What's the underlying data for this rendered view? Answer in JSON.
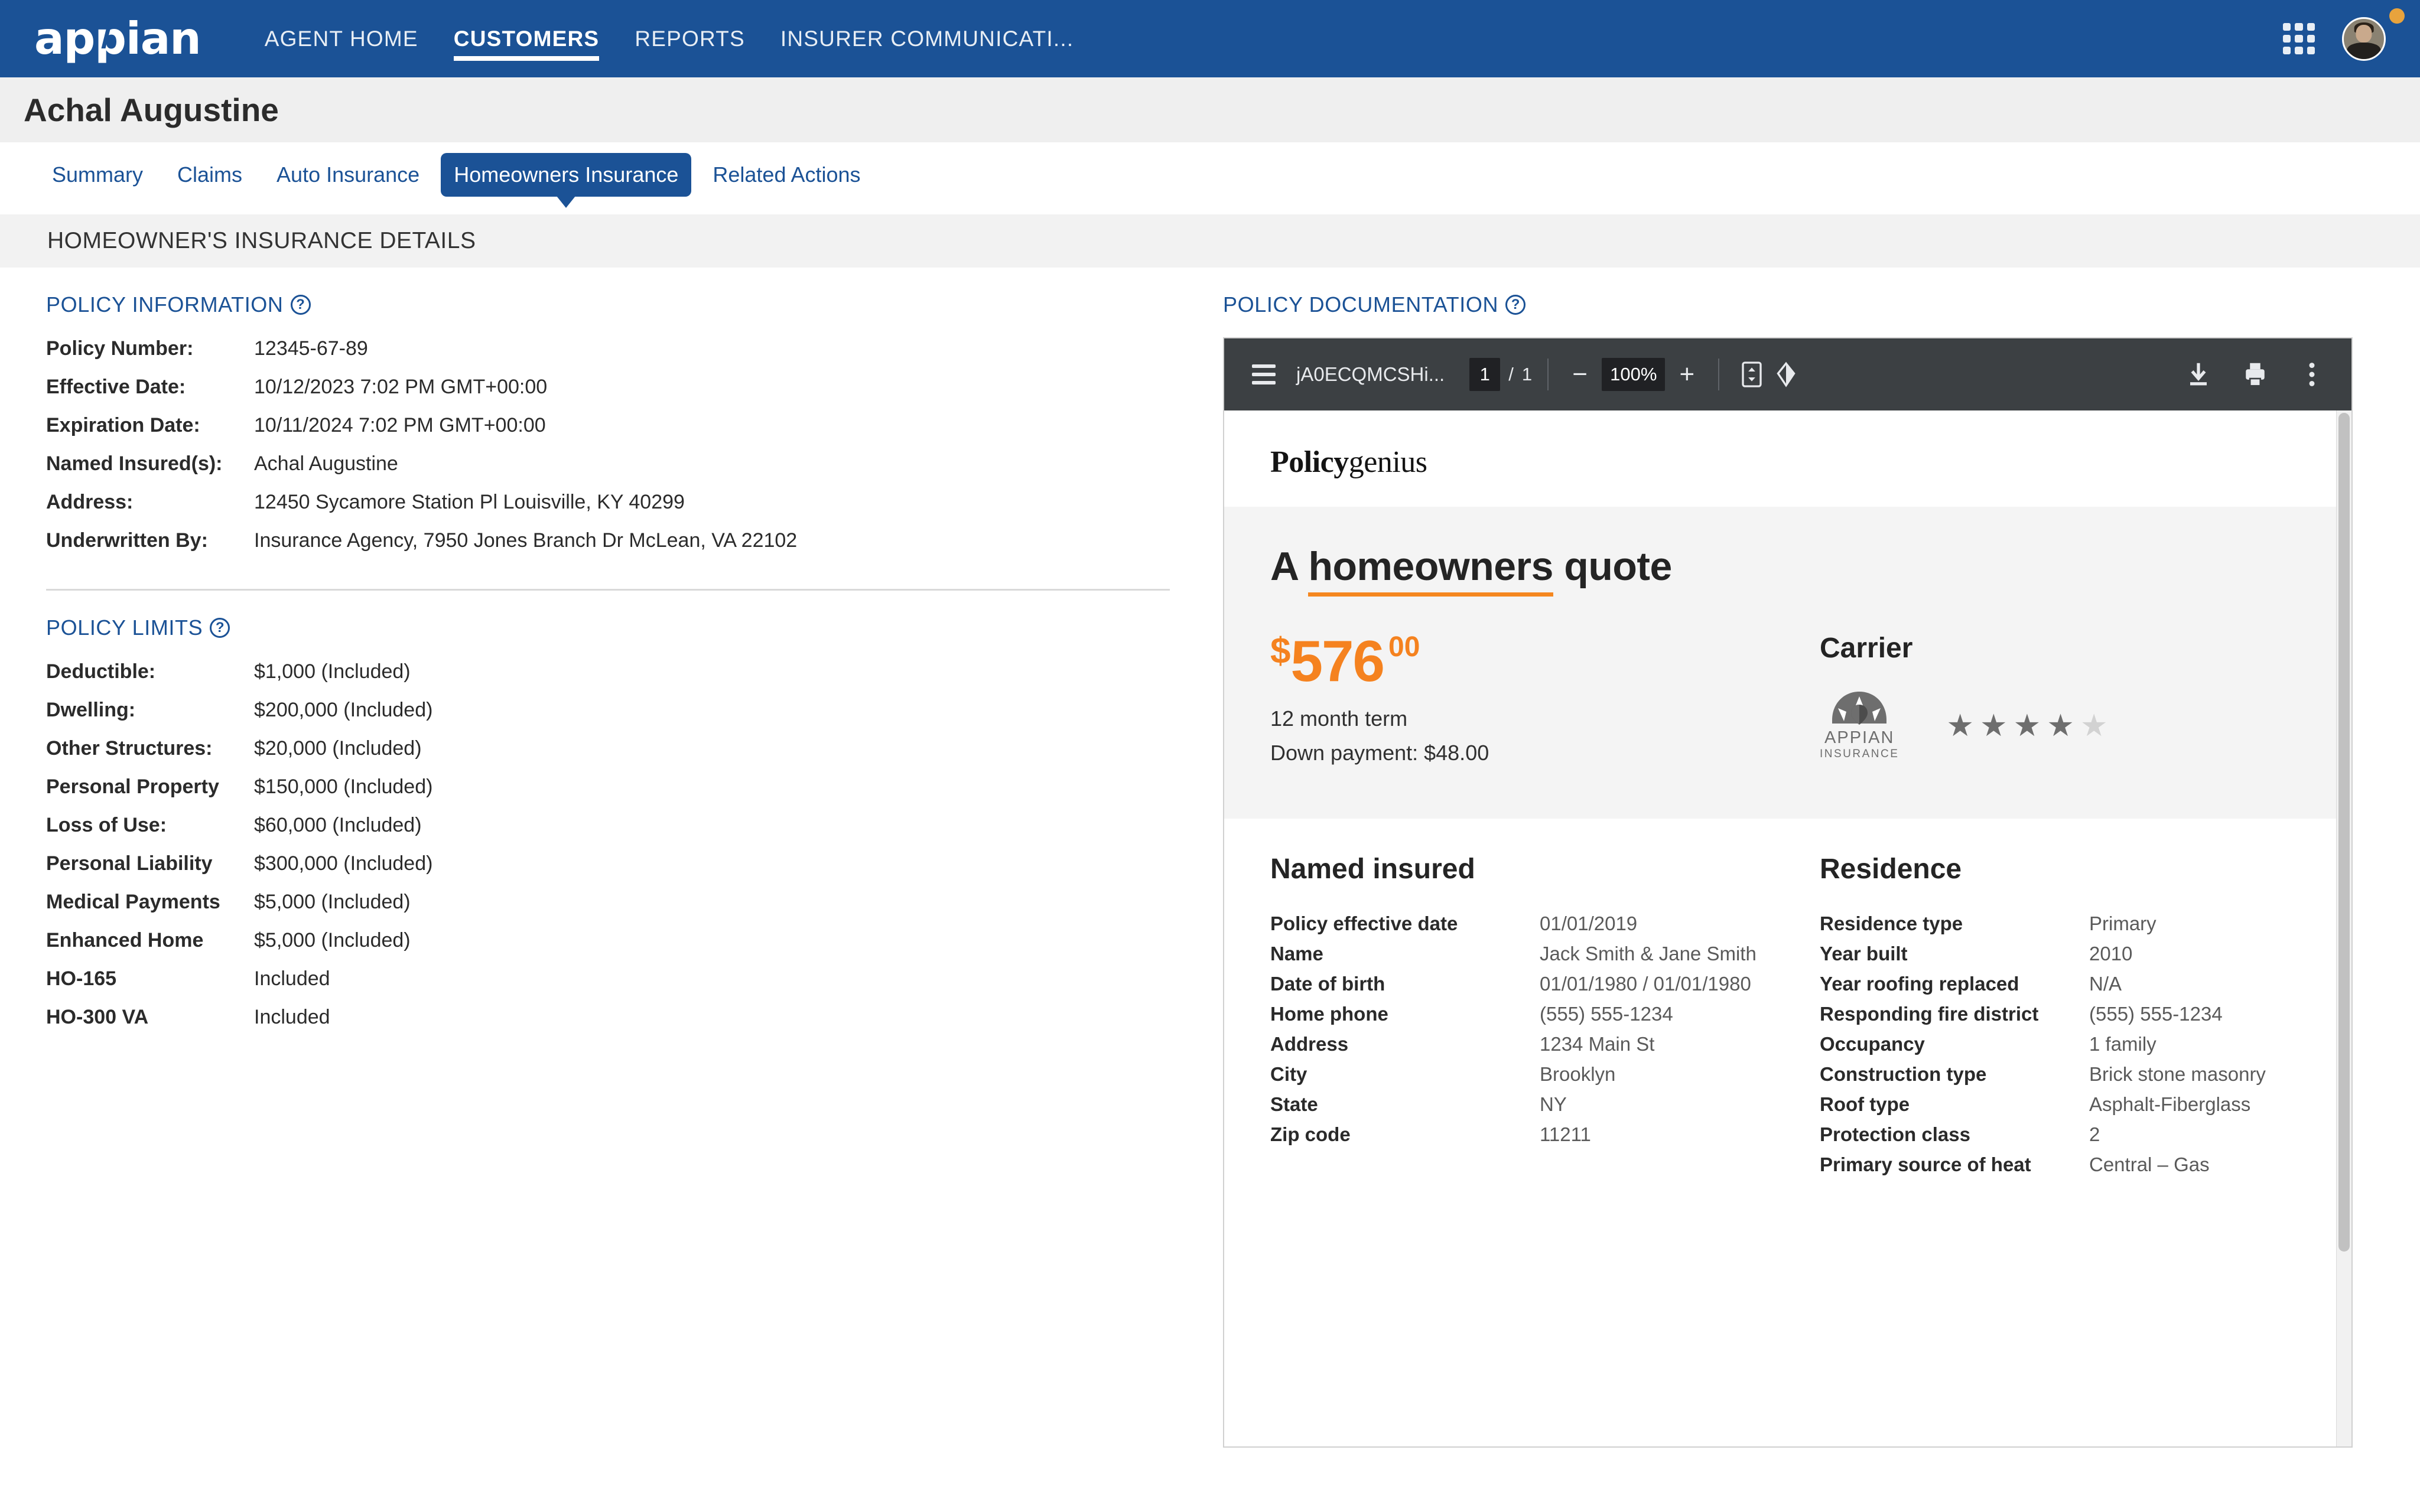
{
  "nav": {
    "logo": "appian",
    "items": [
      {
        "label": "AGENT HOME",
        "active": false
      },
      {
        "label": "CUSTOMERS",
        "active": true
      },
      {
        "label": "REPORTS",
        "active": false
      },
      {
        "label": "INSURER COMMUNICATI...",
        "active": false
      }
    ],
    "brand_color": "#1B5296"
  },
  "page": {
    "title": "Achal Augustine"
  },
  "tabs": [
    {
      "label": "Summary",
      "active": false
    },
    {
      "label": "Claims",
      "active": false
    },
    {
      "label": "Auto Insurance",
      "active": false
    },
    {
      "label": "Homeowners Insurance",
      "active": true
    },
    {
      "label": "Related Actions",
      "active": false
    }
  ],
  "section_band": {
    "title": "HOMEOWNER'S INSURANCE DETAILS"
  },
  "policy_information": {
    "header": "POLICY INFORMATION",
    "help": "?",
    "rows": [
      {
        "label": "Policy Number:",
        "value": "12345-67-89"
      },
      {
        "label": "Effective Date:",
        "value": "10/12/2023 7:02 PM GMT+00:00"
      },
      {
        "label": "Expiration Date:",
        "value": "10/11/2024 7:02 PM GMT+00:00"
      },
      {
        "label": "Named Insured(s):",
        "value": "Achal Augustine"
      },
      {
        "label": "Address:",
        "value": "12450 Sycamore Station Pl Louisville, KY 40299"
      },
      {
        "label": "Underwritten By:",
        "value": "Insurance Agency, 7950 Jones Branch Dr McLean, VA 22102"
      }
    ]
  },
  "policy_limits": {
    "header": "POLICY LIMITS",
    "help": "?",
    "rows": [
      {
        "label": "Deductible:",
        "value": "$1,000 (Included)"
      },
      {
        "label": "Dwelling:",
        "value": "$200,000 (Included)"
      },
      {
        "label": "Other Structures:",
        "value": "$20,000 (Included)"
      },
      {
        "label": "Personal Property",
        "value": "$150,000 (Included)"
      },
      {
        "label": "Loss of Use:",
        "value": "$60,000 (Included)"
      },
      {
        "label": "Personal Liability",
        "value": "$300,000 (Included)"
      },
      {
        "label": "Medical Payments",
        "value": "$5,000 (Included)"
      },
      {
        "label": "Enhanced Home",
        "value": "$5,000 (Included)"
      },
      {
        "label": "HO-165",
        "value": "Included"
      },
      {
        "label": "HO-300 VA",
        "value": "Included"
      }
    ]
  },
  "policy_documentation": {
    "header": "POLICY DOCUMENTATION",
    "help": "?"
  },
  "pdf_viewer": {
    "filename": "jA0ECQMCSHi...",
    "current_page": "1",
    "page_separator": "/",
    "total_pages": "1",
    "zoom_out": "−",
    "zoom_level": "100%",
    "zoom_in": "+",
    "icons": {
      "menu": "hamburger-icon",
      "fit": "fit-page-icon",
      "rotate": "rotate-icon",
      "download": "download-icon",
      "print": "print-icon",
      "more": "more-options-icon"
    }
  },
  "document": {
    "brand_bold": "Policy",
    "brand_light": "genius",
    "title_pre": "A ",
    "title_underlined": "homeowners",
    "title_post": " quote",
    "price": {
      "currency": "$",
      "amount": "576",
      "cents": "00",
      "term": "12 month term",
      "down_payment": "Down payment: $48.00"
    },
    "carrier": {
      "title": "Carrier",
      "name": "APPIAN",
      "subname": "INSURANCE",
      "rating_filled": 4,
      "rating_total": 5
    },
    "named_insured": {
      "title": "Named insured",
      "rows": [
        {
          "label": "Policy effective date",
          "value": "01/01/2019"
        },
        {
          "label": "Name",
          "value": "Jack Smith & Jane Smith"
        },
        {
          "label": "Date of birth",
          "value": "01/01/1980 / 01/01/1980"
        },
        {
          "label": "Home phone",
          "value": "(555) 555-1234"
        },
        {
          "label": "Address",
          "value": "1234 Main St"
        },
        {
          "label": "City",
          "value": "Brooklyn"
        },
        {
          "label": "State",
          "value": "NY"
        },
        {
          "label": "Zip code",
          "value": "11211"
        }
      ]
    },
    "residence": {
      "title": "Residence",
      "rows": [
        {
          "label": "Residence type",
          "value": "Primary"
        },
        {
          "label": "Year built",
          "value": "2010"
        },
        {
          "label": "Year roofing replaced",
          "value": "N/A"
        },
        {
          "label": "Responding fire district",
          "value": "(555) 555-1234"
        },
        {
          "label": "Occupancy",
          "value": "1 family"
        },
        {
          "label": "Construction type",
          "value": "Brick stone masonry"
        },
        {
          "label": "Roof type",
          "value": "Asphalt-Fiberglass"
        },
        {
          "label": "Protection class",
          "value": "2"
        },
        {
          "label": "Primary source of heat",
          "value": "Central – Gas"
        }
      ]
    }
  },
  "colors": {
    "brand": "#1B5296",
    "accent_orange": "#F5821F",
    "badge": "#E8A33D"
  }
}
